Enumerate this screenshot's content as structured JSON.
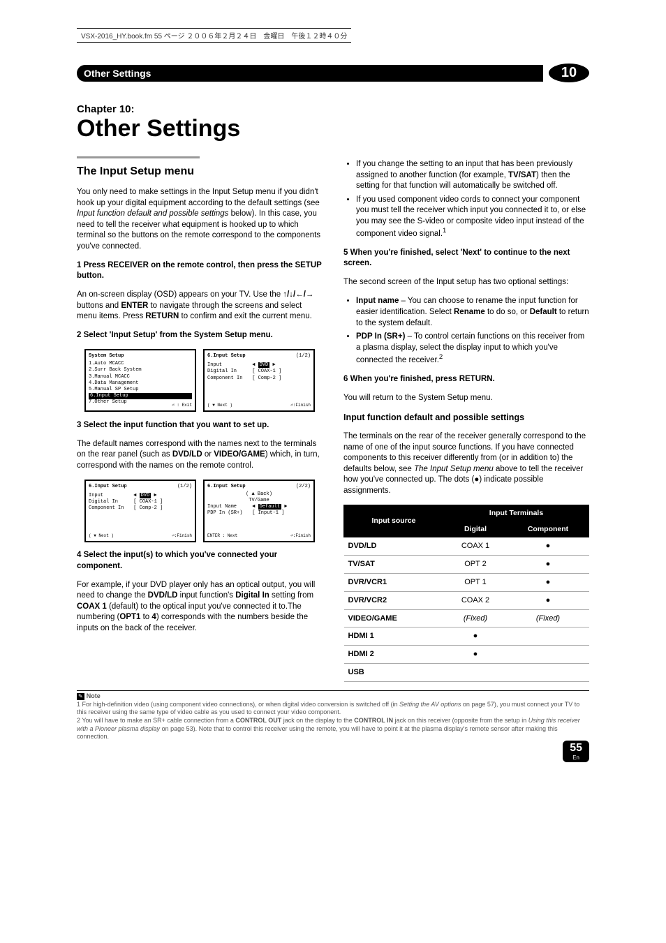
{
  "fm_header": "VSX-2016_HY.book.fm 55 ページ ２００６年２月２４日　金曜日　午後１２時４０分",
  "section_tab": "Other Settings",
  "chapter_num": "10",
  "chapter_line": "Chapter 10:",
  "chapter_title": "Other Settings",
  "left": {
    "h_input_setup": "The Input Setup menu",
    "intro": "You only need to make settings in the Input Setup menu if you didn't hook up your digital equipment according to the default settings (see ",
    "intro_italic": "Input function default and possible settings",
    "intro2": " below). In this case, you need to tell the receiver what equipment is hooked up to which terminal so the buttons on the remote correspond to the components you've connected.",
    "step1": "1   Press RECEIVER on the remote control, then press the SETUP button.",
    "step1_body_a": "An on-screen display (OSD) appears on your TV. Use the ",
    "step1_arrows": "↑/↓/←/→",
    "step1_body_b": " buttons and ",
    "step1_enter": "ENTER",
    "step1_body_c": " to navigate through the screens and select menu items. Press ",
    "step1_return": "RETURN",
    "step1_body_d": " to confirm and exit the current menu.",
    "step2": "2   Select 'Input Setup' from the System Setup menu.",
    "step3": "3   Select the input function that you want to set up.",
    "step3_body": "The default names correspond with the names next to the terminals on the rear panel (such as ",
    "step3_dvd": "DVD/LD",
    "step3_or": " or ",
    "step3_vg": "VIDEO/GAME",
    "step3_body2": ") which, in turn, correspond with the names on the remote control.",
    "step4": "4   Select the input(s) to which you've connected your component.",
    "step4_body_a": "For example, if your DVD player only has an optical output, you will need to change the ",
    "step4_dvd": "DVD/LD",
    "step4_body_b": " input function's ",
    "step4_digin": "Digital In",
    "step4_body_c": " setting from ",
    "step4_coax": "COAX 1",
    "step4_body_d": " (default) to the optical input you've connected it to.The numbering (",
    "step4_opt1": "OPT1",
    "step4_body_e": " to ",
    "step4_four": "4",
    "step4_body_f": ") corresponds with the numbers beside the inputs on the back of the receiver."
  },
  "osd1": {
    "title": "System Setup",
    "items": [
      "1.Auto MCACC",
      "2.Surr Back System",
      "3.Manual MCACC",
      "4.Data Management",
      "5.Manual SP Setup",
      "6.Input Setup",
      "7.Other Setup"
    ],
    "hl_index": 5,
    "footer": "⏎ : Exit"
  },
  "osd2": {
    "title": "6.Input Setup",
    "page": "(1/2)",
    "rows": [
      {
        "k": "Input",
        "v": "DVD",
        "hl": true
      },
      {
        "k": "Digital In",
        "v": "[ COAX-1 ]"
      },
      {
        "k": "Component In",
        "v": "[ Comp-2 ]"
      }
    ],
    "footer_left": "( ▼ Next )",
    "footer": "⏎:Finish"
  },
  "osd3": {
    "title": "6.Input Setup",
    "page": "(1/2)",
    "rows": [
      {
        "k": "Input",
        "v": "DVD",
        "hl": true
      },
      {
        "k": "Digital In",
        "v": "[ COAX-1 ]"
      },
      {
        "k": "Component In",
        "v": "[ Comp-2 ]"
      }
    ],
    "footer_left": "( ▼ Next )",
    "footer": "⏎:Finish"
  },
  "osd4": {
    "title": "6.Input Setup",
    "page": "(2/2)",
    "back": "( ▲ Back)",
    "tvgame": "TV/Game",
    "rows": [
      {
        "k": "Input Name",
        "v": "Default",
        "hl": true
      },
      {
        "k": "PDP In (SR+)",
        "v": "[ Input-1 ]"
      }
    ],
    "footer_left": "ENTER : Next",
    "footer": "⏎:Finish"
  },
  "right": {
    "bullet1_a": "If you change the setting to an input that has been previously assigned to another function (for example, ",
    "bullet1_tvsat": "TV/SAT",
    "bullet1_b": ") then the setting for that function will automatically be switched off.",
    "bullet2": "If you used component video cords to connect your component you must tell the receiver which input you connected it to, or else you may see the S-video or composite video input instead of the component video signal.",
    "sup1": "1",
    "step5": "5   When you're finished, select 'Next' to continue to the next screen.",
    "step5_body": "The second screen of the Input setup has two optional settings:",
    "opt_name_bold": "Input name",
    "opt_name_body_a": " – You can choose to rename the input function for easier identification. Select ",
    "opt_name_rename": "Rename",
    "opt_name_body_b": " to do so, or ",
    "opt_name_default": "Default",
    "opt_name_body_c": " to return to the system default.",
    "opt_pdp_bold": "PDP In (SR+)",
    "opt_pdp_body": " – To control certain functions on this receiver from a plasma display, select the display input to which you've connected the receiver.",
    "sup2": "2",
    "step6": "6   When you're finished, press RETURN.",
    "step6_body": "You will return to the System Setup menu.",
    "h_defaults": "Input function default and possible settings",
    "defaults_body_a": "The terminals on the rear of the receiver generally correspond to the name of one of the input source functions. If you have connected components to this receiver differently from (or in addition to) the defaults below, see ",
    "defaults_italic": "The Input Setup menu",
    "defaults_body_b": " above to tell the receiver how you've connected up. The dots (●) indicate possible assignments."
  },
  "table": {
    "head_src": "Input source",
    "head_term": "Input Terminals",
    "head_dig": "Digital",
    "head_comp": "Component",
    "rows": [
      {
        "src": "DVD/LD",
        "dig": "COAX 1",
        "comp": "●"
      },
      {
        "src": "TV/SAT",
        "dig": "OPT 2",
        "comp": "●"
      },
      {
        "src": "DVR/VCR1",
        "dig": "OPT 1",
        "comp": "●"
      },
      {
        "src": "DVR/VCR2",
        "dig": "COAX 2",
        "comp": "●"
      },
      {
        "src": "VIDEO/GAME",
        "dig": "(Fixed)",
        "comp": "(Fixed)",
        "italic": true
      },
      {
        "src": "HDMI 1",
        "dig": "●",
        "comp": ""
      },
      {
        "src": "HDMI 2",
        "dig": "●",
        "comp": ""
      },
      {
        "src": "USB",
        "dig": "",
        "comp": ""
      }
    ]
  },
  "note_label": "Note",
  "footnote1_a": "1 For high-definition video (using component video connections), or when digital video conversion is switched off (in ",
  "footnote1_i": "Setting the AV options",
  "footnote1_b": " on page 57), you must connect your TV to this receiver using the same type of video cable as you used to connect your video component.",
  "footnote2_a": "2 You will have to make an SR+ cable connection from a ",
  "footnote2_cout": "CONTROL OUT",
  "footnote2_b": " jack on the display to the ",
  "footnote2_cin": "CONTROL IN",
  "footnote2_c": " jack on this receiver (opposite from the setup in ",
  "footnote2_i": "Using this receiver with a Pioneer plasma display",
  "footnote2_d": " on page 53). Note that to control this receiver using the remote, you will have to point it at the plasma display's remote sensor after making this connection.",
  "page_num": "55",
  "page_lang": "En"
}
